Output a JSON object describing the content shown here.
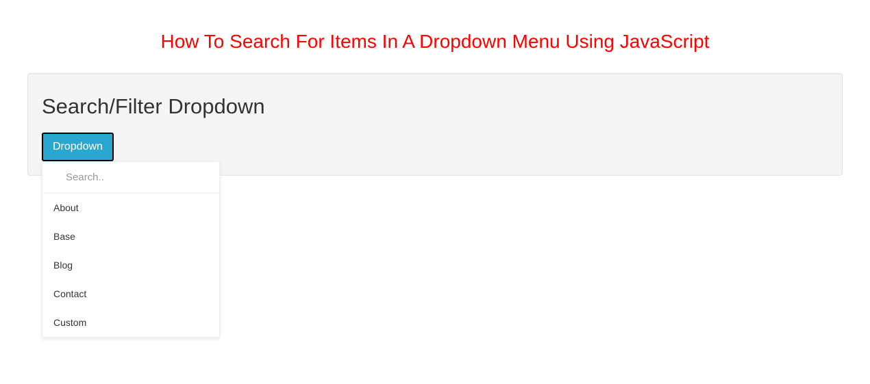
{
  "title": "How To Search For Items In A Dropdown Menu Using JavaScript",
  "panel": {
    "heading": "Search/Filter Dropdown"
  },
  "dropdown": {
    "button_label": "Dropdown",
    "search_placeholder": "Search..",
    "search_value": "",
    "items": [
      {
        "label": "About"
      },
      {
        "label": "Base"
      },
      {
        "label": "Blog"
      },
      {
        "label": "Contact"
      },
      {
        "label": "Custom"
      }
    ]
  }
}
